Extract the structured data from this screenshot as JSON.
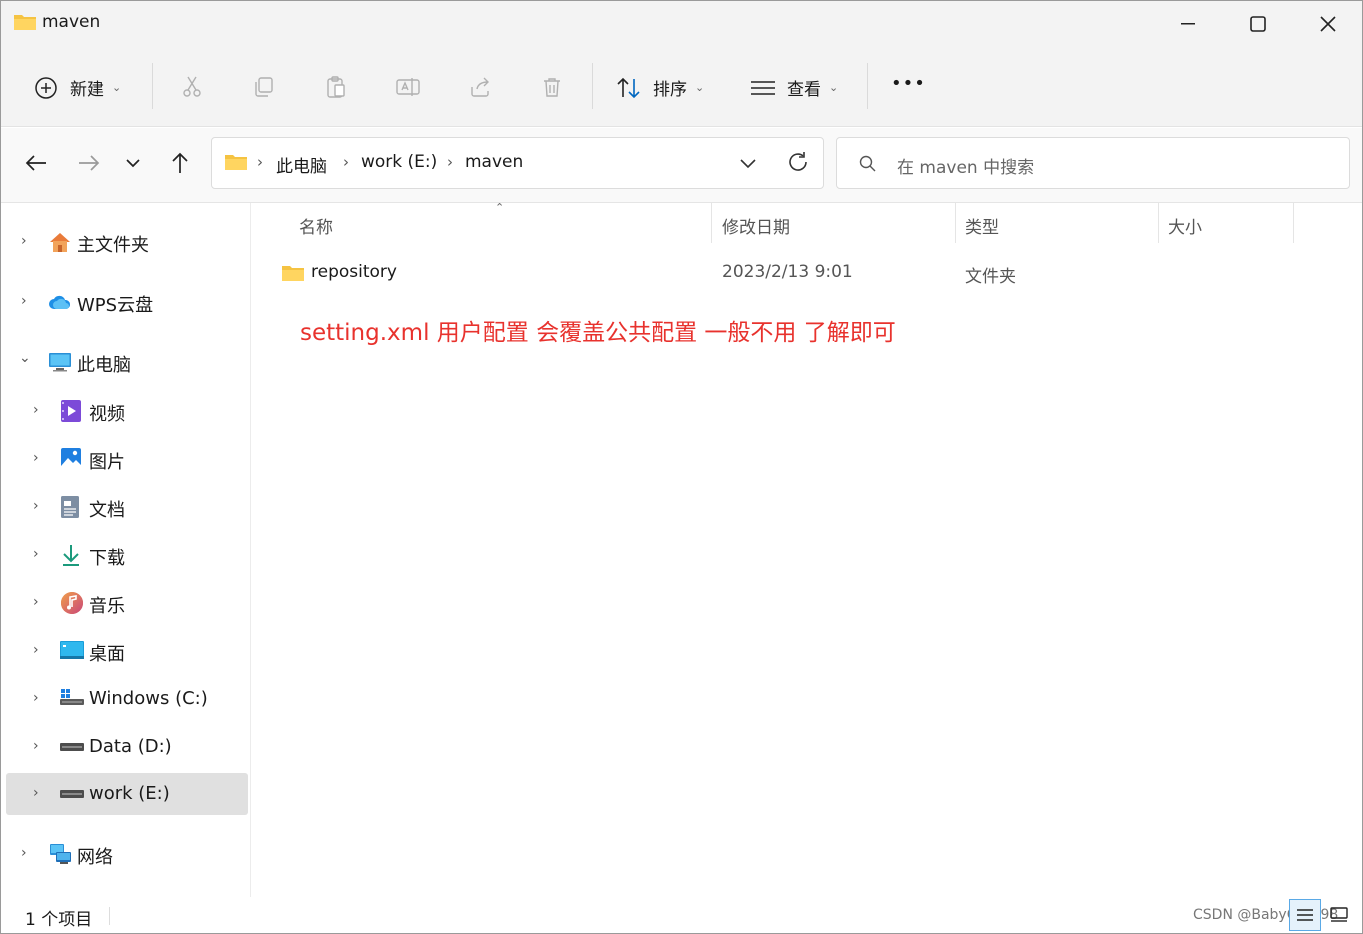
{
  "window": {
    "title": "maven"
  },
  "toolbar": {
    "new_label": "新建",
    "sort_label": "排序",
    "view_label": "查看",
    "more_label": "•••"
  },
  "address": {
    "crumbs": [
      "此电脑",
      "work (E:)",
      "maven"
    ],
    "search_placeholder": "在 maven 中搜索"
  },
  "sidebar": {
    "items": [
      {
        "label": "主文件夹",
        "icon": "home-icon"
      },
      {
        "label": "WPS云盘",
        "icon": "cloud-icon"
      },
      {
        "label": "此电脑",
        "icon": "computer-icon"
      },
      {
        "label": "视频",
        "icon": "video-icon"
      },
      {
        "label": "图片",
        "icon": "picture-icon"
      },
      {
        "label": "文档",
        "icon": "document-icon"
      },
      {
        "label": "下载",
        "icon": "download-icon"
      },
      {
        "label": "音乐",
        "icon": "music-icon"
      },
      {
        "label": "桌面",
        "icon": "desktop-icon"
      },
      {
        "label": "Windows (C:)",
        "icon": "windows-drive-icon"
      },
      {
        "label": "Data (D:)",
        "icon": "drive-icon"
      },
      {
        "label": "work (E:)",
        "icon": "drive-icon"
      },
      {
        "label": "网络",
        "icon": "network-icon"
      }
    ],
    "selected": "work (E:)"
  },
  "columns": {
    "name": "名称",
    "modified": "修改日期",
    "type": "类型",
    "size": "大小"
  },
  "files": [
    {
      "name": "repository",
      "modified": "2023/2/13 9:01",
      "type": "文件夹",
      "size": ""
    }
  ],
  "annotation": "setting.xml 用户配置 会覆盖公共配置 一般不用 了解即可",
  "status": {
    "count": "1 个项目"
  },
  "watermark": "CSDN @BabyOf2198",
  "colors": {
    "annotation": "#e8322d",
    "folder": "#f5c342",
    "accent": "#0067c0"
  }
}
